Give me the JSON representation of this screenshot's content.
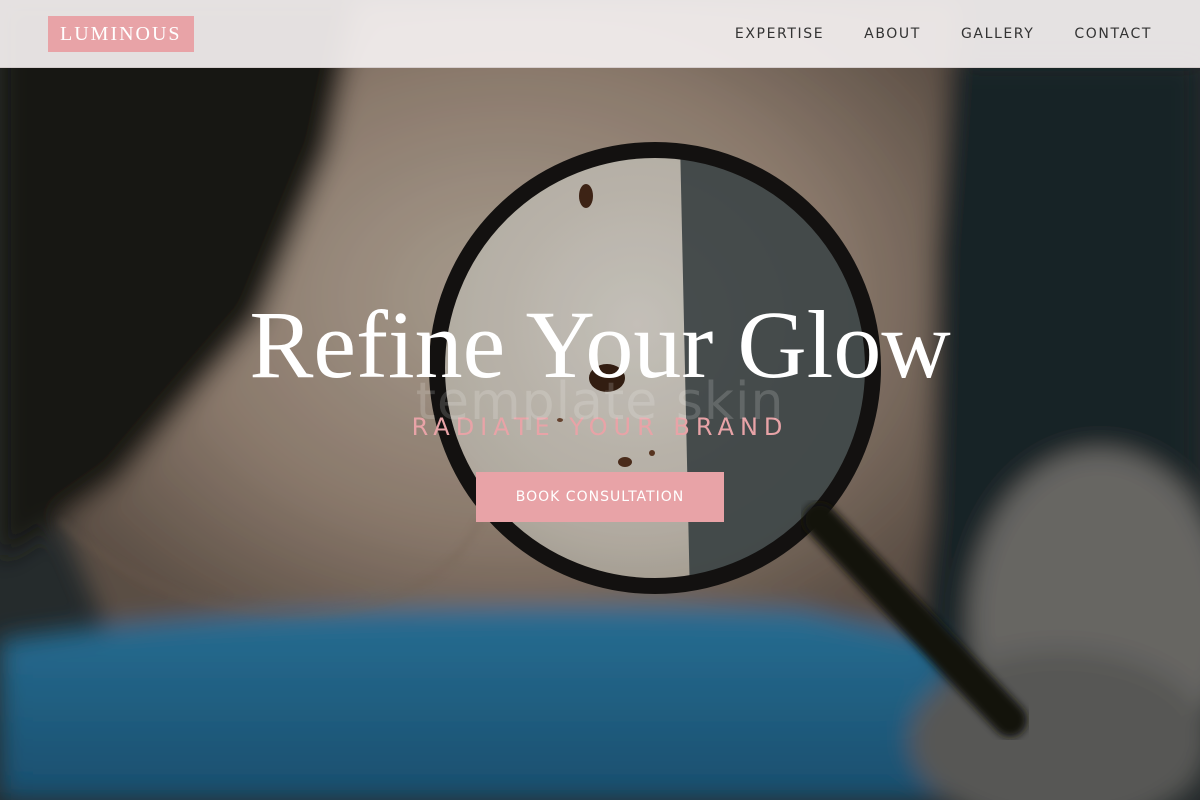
{
  "colors": {
    "accent": "#e8a3a7",
    "header_bg": "#f4f0f0",
    "nav_text": "#333333"
  },
  "header": {
    "logo": "LUMINOUS",
    "nav": [
      {
        "label": "EXPERTISE"
      },
      {
        "label": "ABOUT"
      },
      {
        "label": "GALLERY"
      },
      {
        "label": "CONTACT"
      }
    ]
  },
  "hero": {
    "title": "Refine Your Glow",
    "watermark": "template skin",
    "tagline": "RADIATE YOUR BRAND",
    "cta_label": "BOOK CONSULTATION"
  }
}
